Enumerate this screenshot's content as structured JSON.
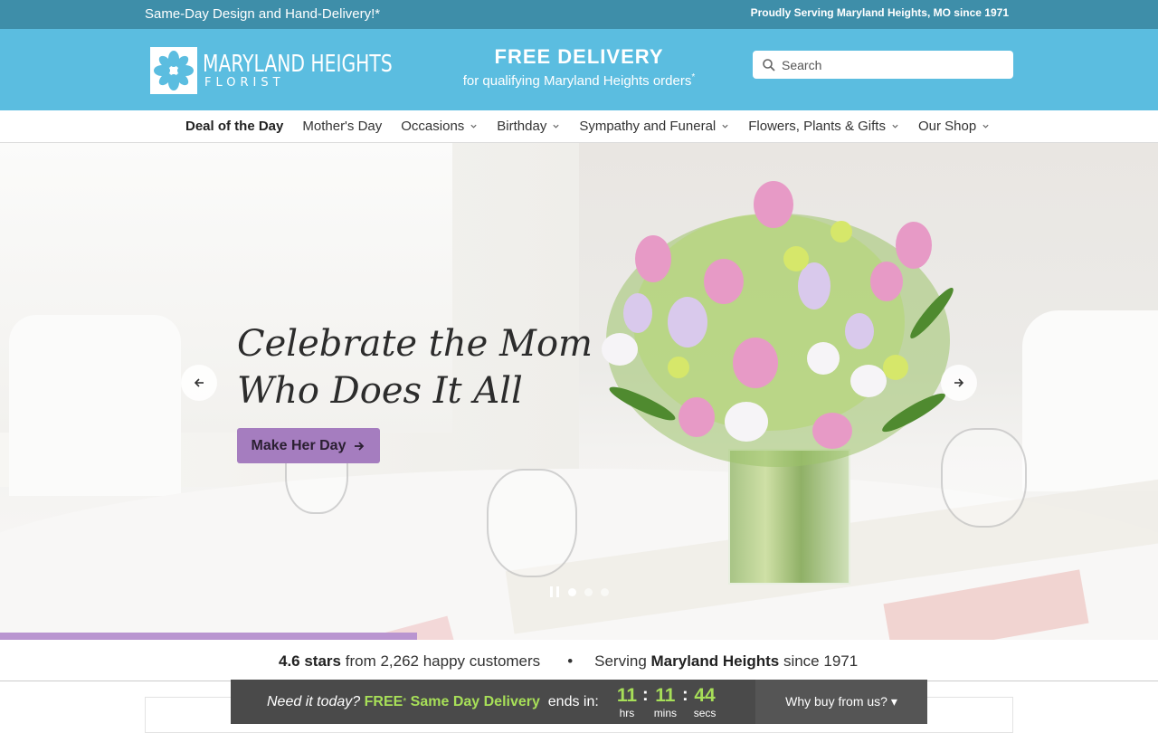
{
  "topbar": {
    "left": "Same-Day Design and Hand-Delivery!*",
    "right": "Proudly Serving Maryland Heights, MO since 1971"
  },
  "header": {
    "logo_line1": "MARYLAND HEIGHTS",
    "logo_line2": "FLORIST",
    "free_title": "FREE DELIVERY",
    "free_sub": "for qualifying Maryland Heights orders",
    "free_sub_mark": "*",
    "search_placeholder": "Search"
  },
  "nav": {
    "items": [
      {
        "label": "Deal of the Day"
      },
      {
        "label": "Mother's Day"
      },
      {
        "label": "Occasions"
      },
      {
        "label": "Birthday"
      },
      {
        "label": "Sympathy and Funeral"
      },
      {
        "label": "Flowers, Plants & Gifts"
      },
      {
        "label": "Our Shop"
      }
    ]
  },
  "hero": {
    "headline_line1": "Celebrate the Mom",
    "headline_line2": "Who Does It All",
    "cta_label": "Make Her Day",
    "slide_progress": 0.36
  },
  "rating": {
    "stars": "4.6 stars",
    "customers": "from 2,262 happy customers",
    "bullet": "•",
    "serving": "Serving",
    "city": "Maryland Heights",
    "since": "since 1971"
  },
  "countdown": {
    "need": "Need it today?",
    "free": "FREE",
    "free_mark": "*",
    "same_day": "Same Day Delivery",
    "ends_in": "ends in:",
    "hrs": "11",
    "mins": "11",
    "secs": "44",
    "hrs_label": "hrs",
    "mins_label": "mins",
    "secs_label": "secs",
    "why": "Why buy from us? ▾"
  },
  "colors": {
    "topbar": "#3e8ea9",
    "header": "#5bbde0",
    "cta": "#a57dbf",
    "countdown_green": "#a7df58"
  },
  "icons": [
    "flower-logo-icon",
    "search-icon",
    "chevron-down-icon",
    "arrow-left-icon",
    "arrow-right-icon",
    "pause-icon"
  ]
}
